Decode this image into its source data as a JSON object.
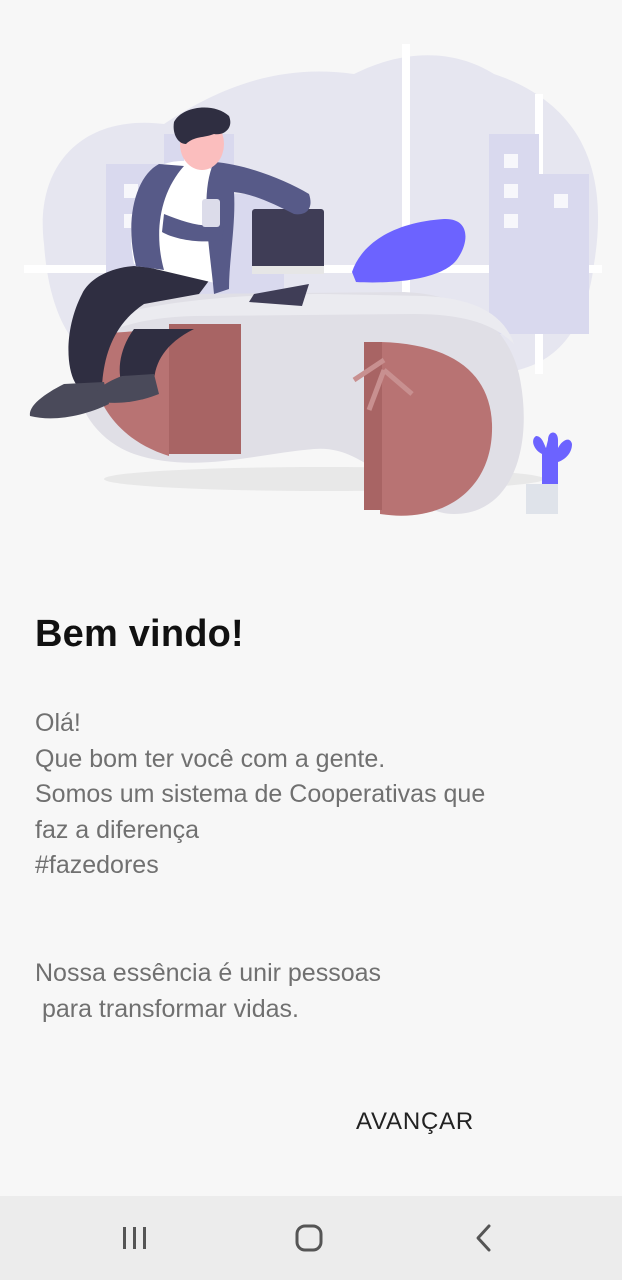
{
  "onboarding": {
    "title": "Bem vindo!",
    "intro_lines": [
      "Olá!",
      "Que bom ter você com a gente.",
      "Somos um sistema de Cooperativas que",
      "faz a diferença",
      "#fazedores"
    ],
    "essence_lines": [
      "Nossa essência é unir pessoas",
      " para transformar vidas."
    ],
    "next_label": "AVANÇAR"
  },
  "illustration": {
    "icon": "person-sitting-on-desk-illustration",
    "accent_color": "#6c63ff",
    "blob_color": "#e6e6f0"
  },
  "system_nav": {
    "recent_icon": "recent-apps-icon",
    "home_icon": "home-icon",
    "back_icon": "back-icon"
  }
}
